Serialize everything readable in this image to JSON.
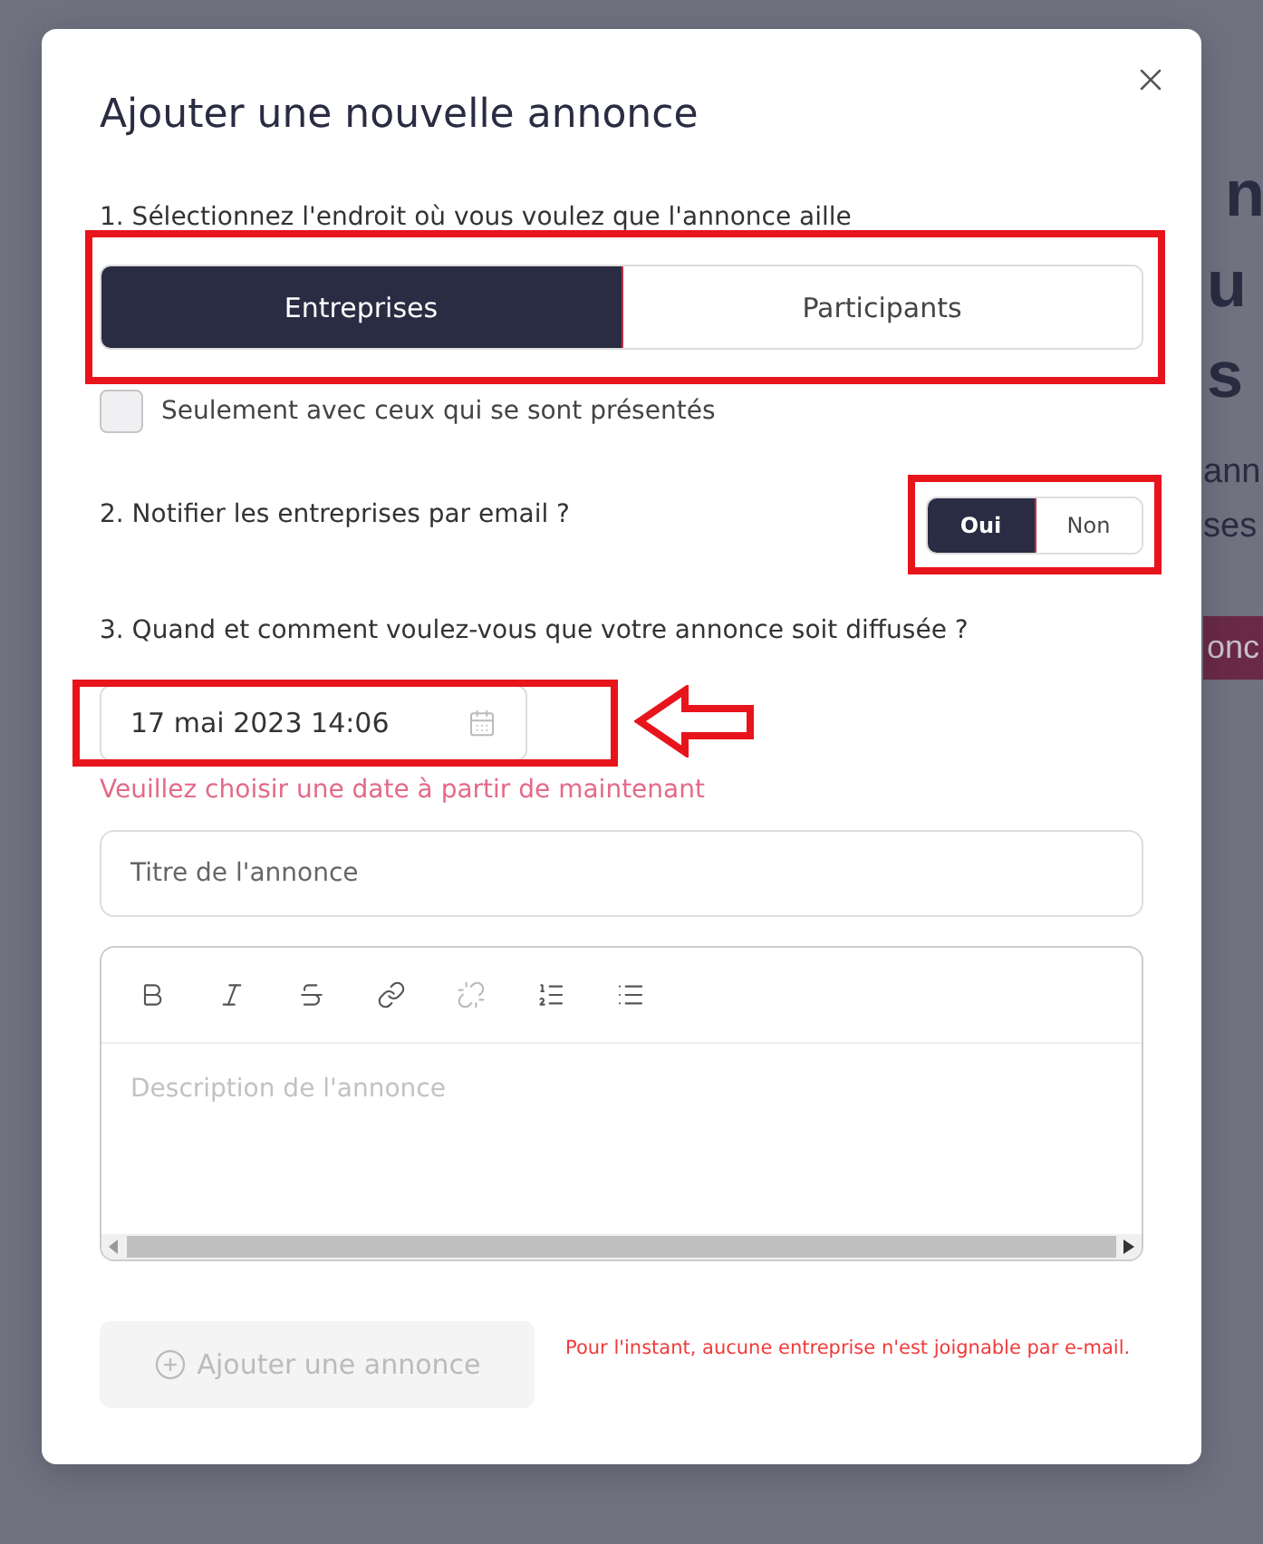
{
  "background_fragments": [
    {
      "kind": "heading",
      "text": "n"
    },
    {
      "kind": "heading",
      "text": "u"
    },
    {
      "kind": "heading",
      "text": "s"
    },
    {
      "kind": "body",
      "text": "ann"
    },
    {
      "kind": "body",
      "text": "ses"
    },
    {
      "kind": "button",
      "text": "onc"
    }
  ],
  "dialog": {
    "title": "Ajouter une nouvelle annonce",
    "target": {
      "label": "1. Sélectionnez l'endroit où vous voulez que l'annonce aille",
      "options": [
        {
          "label": "Entreprises",
          "selected": true
        },
        {
          "label": "Participants",
          "selected": false
        }
      ],
      "only_presented": {
        "label": "Seulement avec ceux qui se sont présentés",
        "checked": false
      }
    },
    "notify": {
      "label": "2. Notifier les entreprises par email ?",
      "options": [
        {
          "label": "Oui",
          "selected": true
        },
        {
          "label": "Non",
          "selected": false
        }
      ]
    },
    "schedule": {
      "label": "3. Quand et comment voulez-vous que votre annonce soit diffusée ?",
      "date": "17 mai 2023 14:06",
      "error": "Veuillez choisir une date à partir de maintenant"
    },
    "title_field": {
      "placeholder": "Titre de l'annonce"
    },
    "editor": {
      "tools": [
        {
          "kind": "bold",
          "disabled": false
        },
        {
          "kind": "italic",
          "disabled": false
        },
        {
          "kind": "strike",
          "disabled": false
        },
        {
          "kind": "link",
          "disabled": false
        },
        {
          "kind": "unlink",
          "disabled": true
        },
        {
          "kind": "ordered",
          "disabled": false
        },
        {
          "kind": "bullets",
          "disabled": false
        }
      ],
      "placeholder": "Description de l'annonce"
    },
    "submit": {
      "label": "Ajouter une annonce",
      "disabled": true
    },
    "note": "Pour l'instant, aucune entreprise n'est joignable par e-mail."
  }
}
